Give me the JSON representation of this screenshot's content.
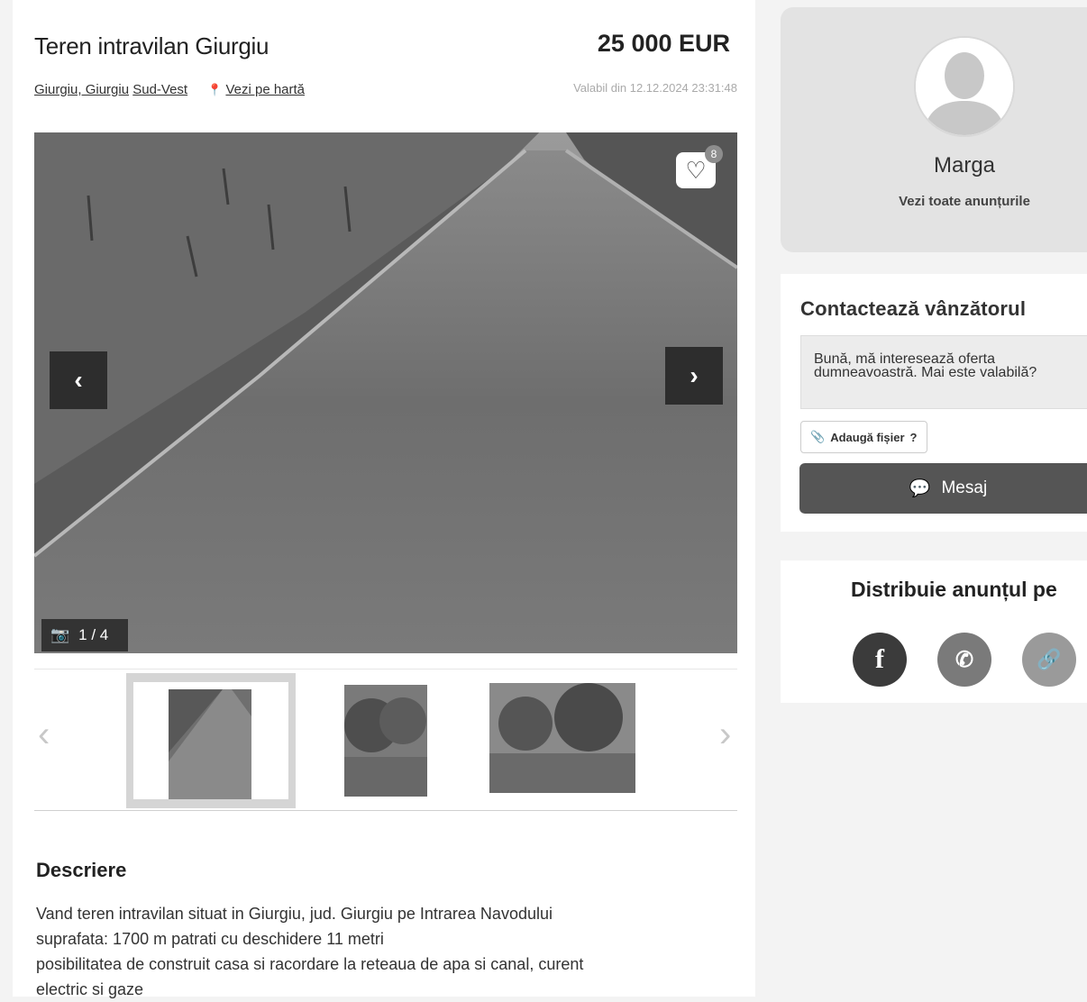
{
  "listing": {
    "title": "Teren intravilan Giurgiu",
    "price": "25 000 EUR",
    "location_city": "Giurgiu, Giurgiu",
    "location_area": "Sud-Vest",
    "map_link": "Vezi pe hartă",
    "valid_since": "Valabil din 12.12.2024 23:31:48"
  },
  "gallery": {
    "favorites_count": "8",
    "photo_counter": "1 / 4",
    "prev_label": "‹",
    "next_label": "›",
    "thumb_prev": "‹",
    "thumb_next": "›",
    "selected_thumb": 1
  },
  "description": {
    "title": "Descriere",
    "lines": [
      "Vand teren intravilan situat in Giurgiu, jud. Giurgiu pe Intrarea Navodului",
      "suprafata: 1700 m patrati cu deschidere 11 metri",
      "posibilitatea de construit casa si racordare la reteaua de apa si canal, curent",
      "electric si gaze"
    ]
  },
  "seller": {
    "name": "Marga",
    "all_listings": "Vezi toate anunțurile"
  },
  "contact": {
    "title": "Contactează vânzătorul",
    "message": "Bună, mă interesează oferta dumneavoastră. Mai este valabilă?",
    "attach_label": "Adaugă fișier",
    "attach_help": "?",
    "send_label": "Mesaj"
  },
  "share": {
    "title": "Distribuie anunțul pe",
    "icons": [
      "facebook-icon",
      "whatsapp-icon",
      "link-icon"
    ],
    "colors": {
      "facebook": "#3b3b3b",
      "whatsapp": "#7a7a7a",
      "link": "#9a9a9a"
    }
  }
}
